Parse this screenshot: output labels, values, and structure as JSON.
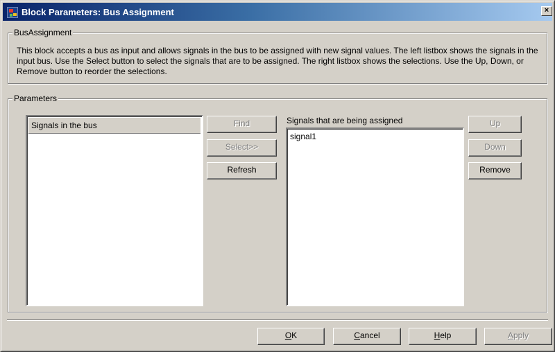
{
  "window": {
    "title": "Block Parameters: Bus Assignment",
    "close_glyph": "×"
  },
  "bus_assignment": {
    "legend": "BusAssignment",
    "description": "This block accepts a bus as input and allows signals in the bus to be assigned with new signal values. The left listbox shows the signals in the input bus. Use the Select button to select the signals that are to be assigned. The right listbox shows the selections. Use the Up, Down, or Remove button to reorder the selections."
  },
  "parameters": {
    "legend": "Parameters",
    "bus_list": {
      "header": "Signals in the bus",
      "items": []
    },
    "middle_buttons": {
      "find": "Find",
      "select": "Select>>",
      "refresh": "Refresh"
    },
    "assigned_list": {
      "label": "Signals that are being assigned",
      "items": [
        "signal1"
      ]
    },
    "right_buttons": {
      "up": "Up",
      "down": "Down",
      "remove": "Remove"
    }
  },
  "footer": {
    "ok": "OK",
    "cancel": "Cancel",
    "help": "Help",
    "apply": "Apply"
  },
  "icons": {
    "app_icon": "simulink-block-icon",
    "close": "close-icon"
  }
}
